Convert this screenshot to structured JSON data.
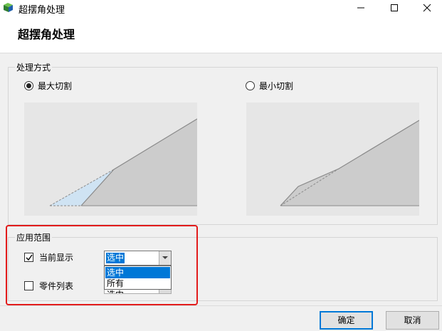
{
  "window": {
    "title": "超摆角处理",
    "icon": "app-icon",
    "controls": [
      "minimize-icon",
      "maximize-icon",
      "close-icon"
    ]
  },
  "header": {
    "title": "超摆角处理"
  },
  "mode_group": {
    "label": "处理方式",
    "options": [
      {
        "label": "最大切割",
        "checked": true
      },
      {
        "label": "最小切割",
        "checked": false
      }
    ]
  },
  "scope_group": {
    "label": "应用范围",
    "current_display": {
      "label": "当前显示",
      "checked": true,
      "value": "选中"
    },
    "part_list": {
      "label": "零件列表",
      "checked": false,
      "value_partial": "选中"
    },
    "dropdown_options": [
      "选中",
      "所有"
    ],
    "highlighted_option": "选中"
  },
  "footer": {
    "ok_label": "确定",
    "cancel_label": "取消"
  },
  "colors": {
    "accent": "#0078d7",
    "highlight_frame": "#e21b1b",
    "shape_fill": "#cccccc",
    "cut_region": "#cfe3f3"
  }
}
